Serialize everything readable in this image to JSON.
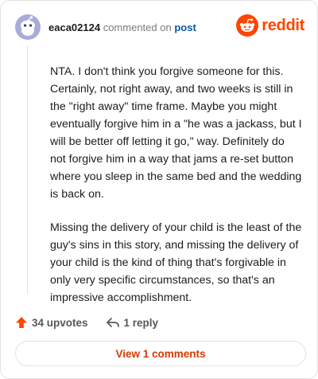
{
  "comment": {
    "username": "eaca02124",
    "action_text": "commented on",
    "post_link": "post",
    "avatar_icon": "snoo-avatar-icon",
    "paragraphs": [
      "NTA. I don't think you forgive someone for this. Certainly, not right away, and two weeks is still in the \"right away\" time frame. Maybe you might eventually forgive him in a \"he was a jackass, but I will be better off letting it go,\" way. Definitely do not forgive him in a way that jams a re-set button where you sleep in the same bed and the wedding is back on.",
      "Missing the delivery of your child is the least of the guy's sins in this story, and missing the delivery of your child is the kind of thing that's forgivable in only very specific circumstances, so that's an impressive accomplishment."
    ]
  },
  "brand": {
    "icon": "reddit-logo-icon",
    "wordmark": "reddit",
    "color": "#ff4500"
  },
  "actions": {
    "upvotes_label": "34 upvotes",
    "upvote_icon": "upvote-arrow-icon",
    "reply_label": "1 reply",
    "reply_icon": "reply-arrow-icon"
  },
  "view_comments_label": "View 1 comments",
  "colors": {
    "accent": "#ff4500",
    "link": "#0b57a8",
    "button_text": "#d93a00",
    "avatar": "#a9acda"
  }
}
